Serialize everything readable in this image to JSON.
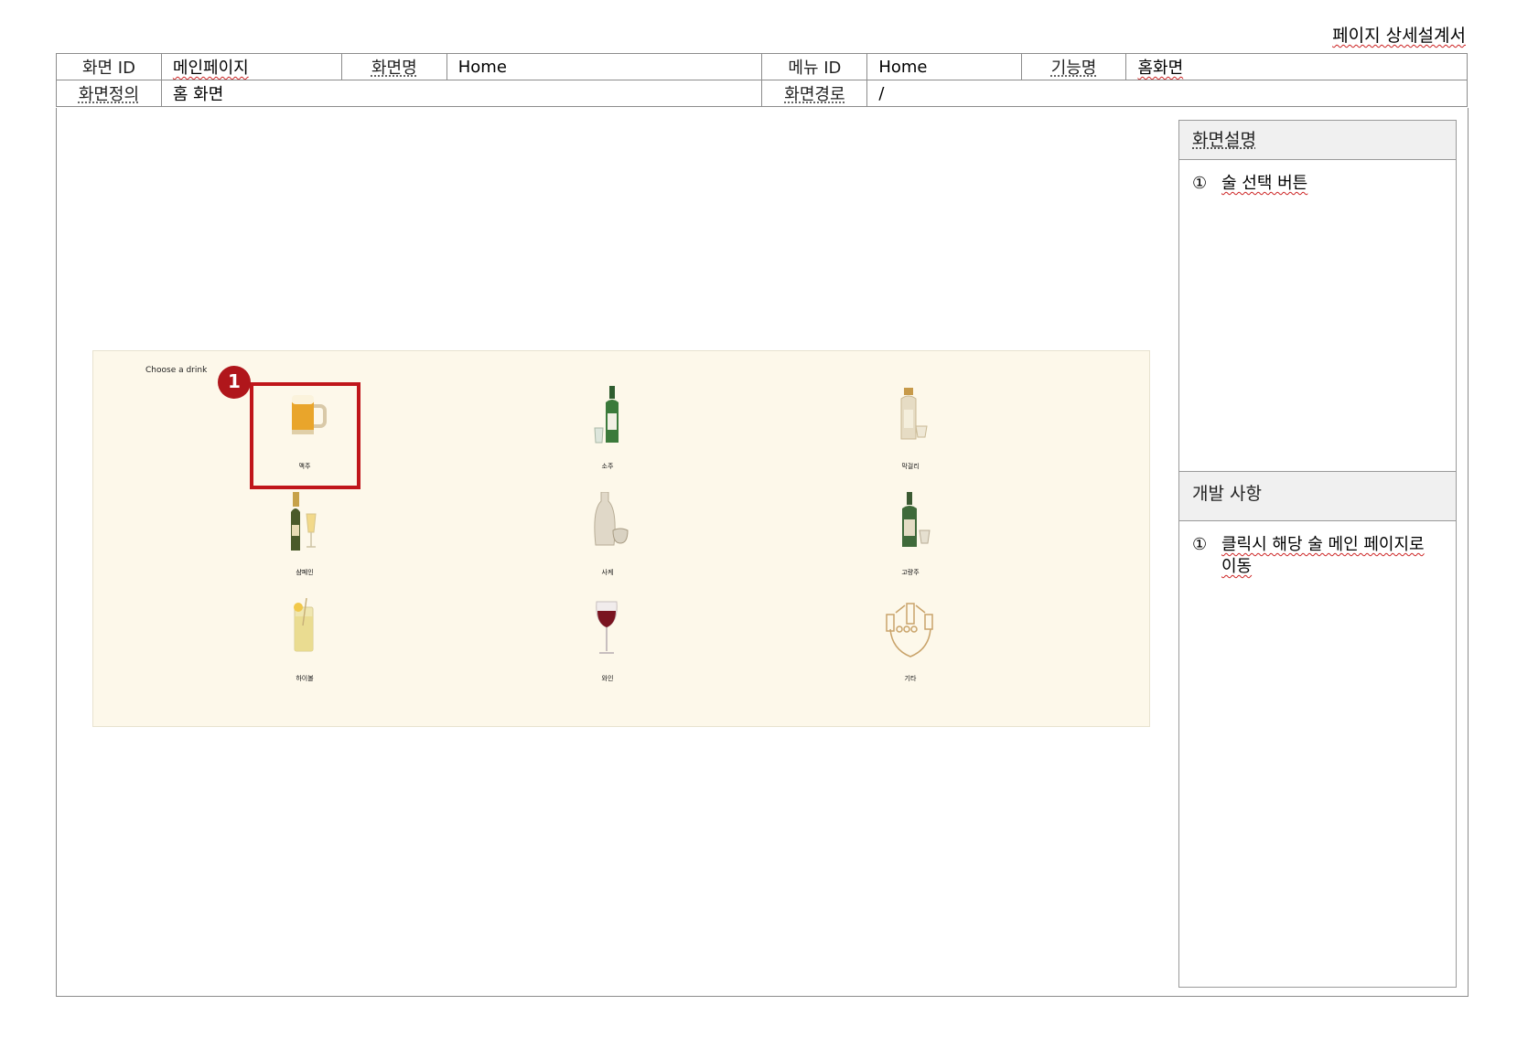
{
  "document": {
    "title": "페이지 상세설계서"
  },
  "meta": {
    "screen_id_label": "화면 ID",
    "screen_id_value": "메인페이지",
    "screen_name_label": "화면명",
    "screen_name_value": "Home",
    "menu_id_label": "메뉴 ID",
    "menu_id_value": "Home",
    "function_label": "기능명",
    "function_value": "홈화면",
    "definition_label": "화면정의",
    "definition_value": "홈 화면",
    "path_label": "화면경로",
    "path_value": "/"
  },
  "mockup": {
    "title": "Choose a drink",
    "drinks": [
      {
        "name": "맥주",
        "icon": "beer-mug-icon"
      },
      {
        "name": "소주",
        "icon": "soju-bottle-icon"
      },
      {
        "name": "막걸리",
        "icon": "makgeolli-bottle-icon"
      },
      {
        "name": "샴페인",
        "icon": "champagne-icon"
      },
      {
        "name": "사케",
        "icon": "sake-icon"
      },
      {
        "name": "고량주",
        "icon": "kaoliang-bottle-icon"
      },
      {
        "name": "하이볼",
        "icon": "highball-icon"
      },
      {
        "name": "와인",
        "icon": "wine-glass-icon"
      },
      {
        "name": "기타",
        "icon": "other-drinks-icon"
      }
    ],
    "marker": "1",
    "highlight_color": "#c0161b",
    "background_color": "#fdf8ea"
  },
  "description": {
    "title": "화면설명",
    "items": [
      {
        "num": "①",
        "text": "술 선택 버튼"
      }
    ]
  },
  "development": {
    "title": "개발 사항",
    "items": [
      {
        "num": "①",
        "text": "클릭시 해당 술 메인 페이지로 이동"
      }
    ]
  }
}
